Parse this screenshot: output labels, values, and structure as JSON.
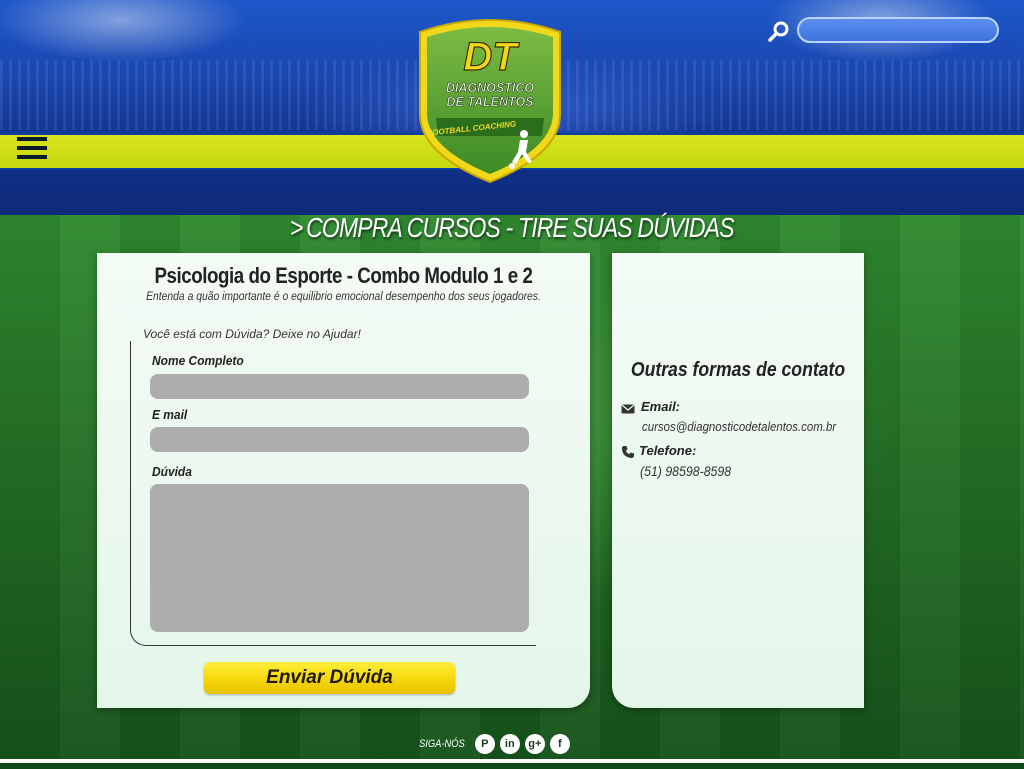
{
  "header": {
    "logo": {
      "initials": "DT",
      "name_line1": "DIAGNOSTICO",
      "name_line2": "DE TALENTOS",
      "tagline": "FOOTBALL COACHING"
    },
    "search": {
      "placeholder": "",
      "icon": "search-icon"
    },
    "menu_icon": "hamburger-menu-icon"
  },
  "page": {
    "chevron": ">",
    "title": "COMPRA CURSOS - TIRE SUAS DÚVIDAS"
  },
  "course": {
    "title": "Psicologia do Esporte - Combo Modulo 1 e 2",
    "subtitle": "Entenda a quão importante é o equilibrio emocional desempenho dos seus jogadores."
  },
  "form": {
    "note": "Você está com Dúvida? Deixe no Ajudar!",
    "name_label": "Nome Completo",
    "name_value": "",
    "email_label": "E mail",
    "email_value": "",
    "question_label": "Dúvida",
    "question_value": "",
    "submit_label": "Enviar Dúvida"
  },
  "contact": {
    "title": "Outras formas de contato",
    "email_label": "Email:",
    "email_value": "cursos@diagnosticodetalentos.com.br",
    "phone_label": "Telefone:",
    "phone_value": "(51) 98598-8598"
  },
  "footer": {
    "follow_label": "SIGA-NÓS",
    "social": [
      {
        "name": "pinterest-icon",
        "glyph": "P"
      },
      {
        "name": "linkedin-icon",
        "glyph": "in"
      },
      {
        "name": "google-plus-icon",
        "glyph": "g+"
      },
      {
        "name": "facebook-icon",
        "glyph": "f"
      }
    ]
  },
  "colors": {
    "sky_blue": "#1a47b0",
    "band_yellow": "#d2de16",
    "grass_green": "#246f25",
    "button_yellow": "#f6d60b",
    "field_gray": "#adadad"
  }
}
